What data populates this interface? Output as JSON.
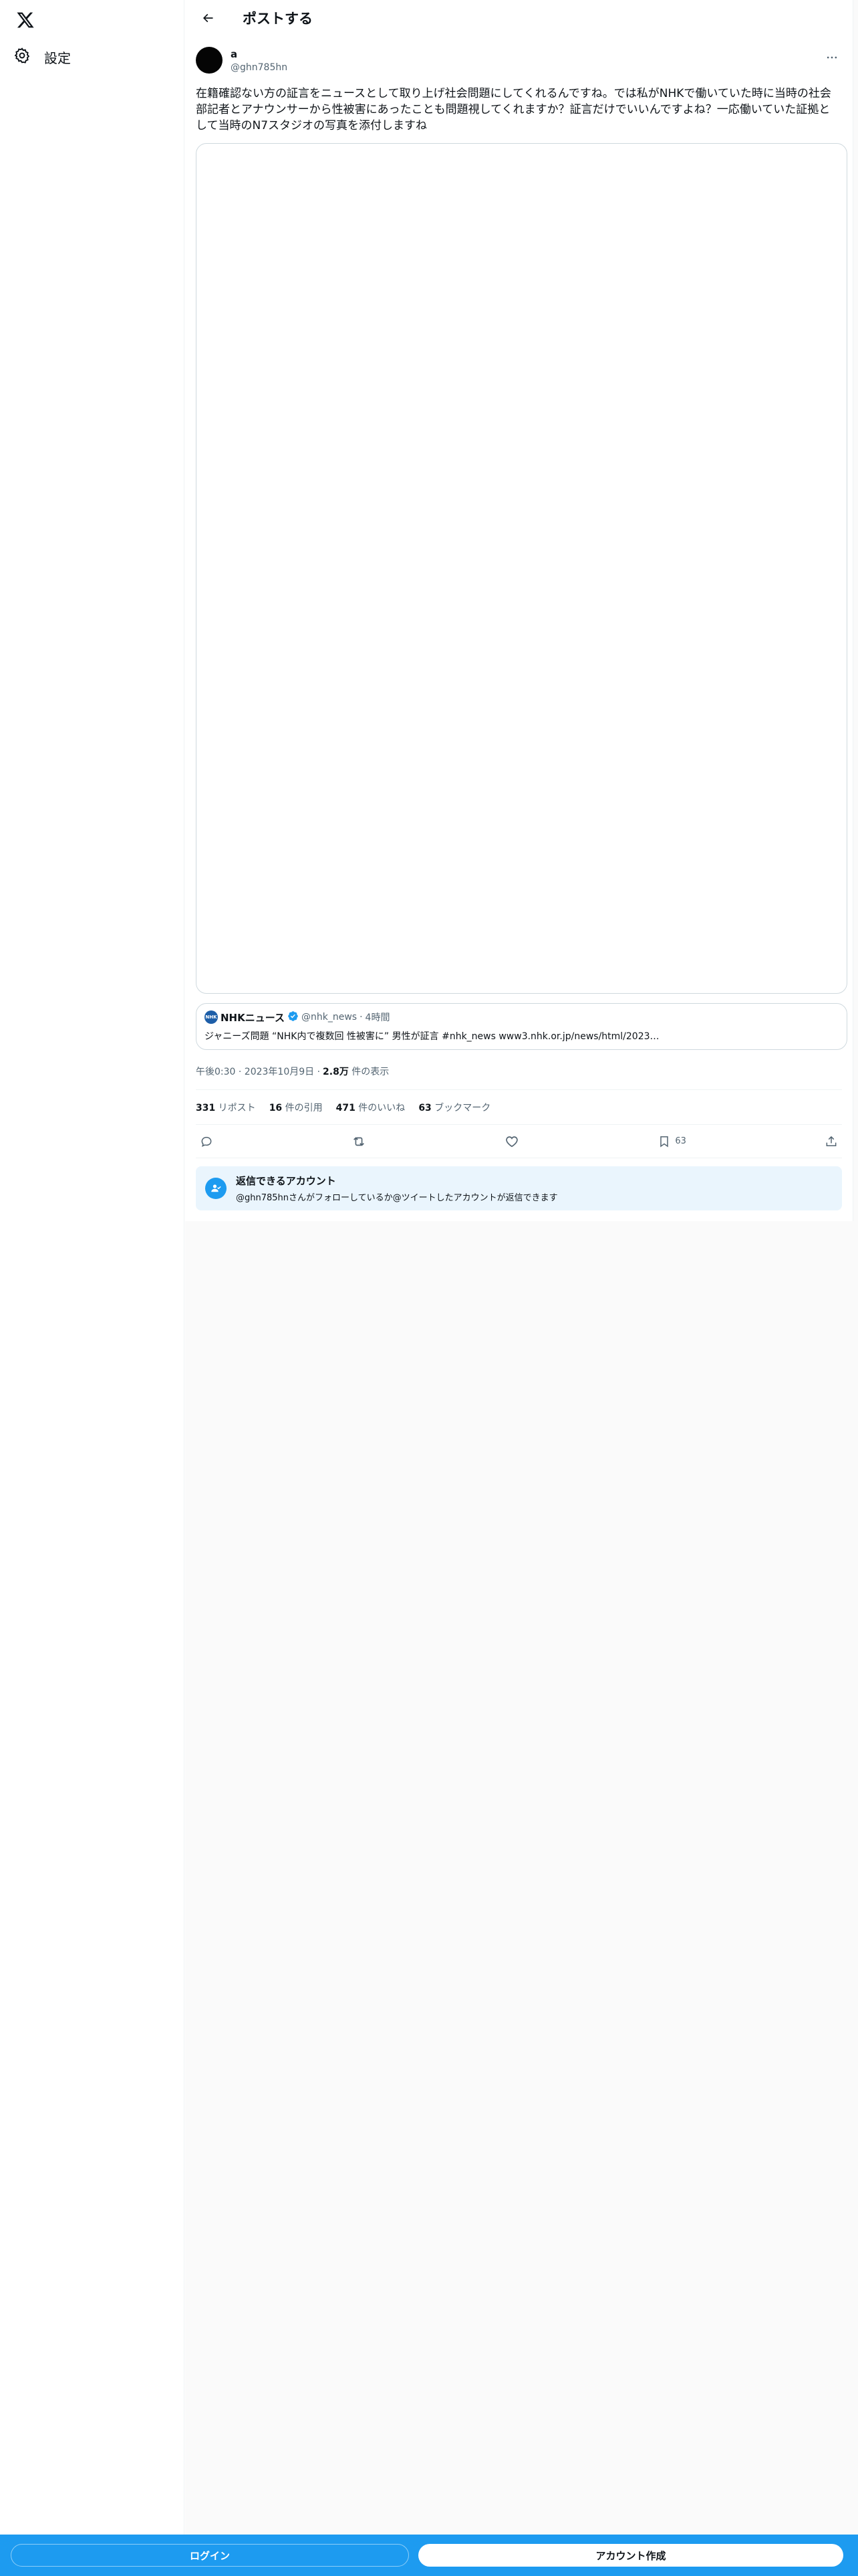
{
  "sidebar": {
    "logo_icon": "x-logo-icon",
    "settings_label": "設定"
  },
  "header": {
    "title": "ポストする"
  },
  "post": {
    "author_name": "a",
    "author_handle": "@ghn785hn",
    "text": "在籍確認ない方の証言をニュースとして取り上げ社会問題にしてくれるんですね。では私がNHKで働いていた時に当時の社会部記者とアナウンサーから性被害にあったことも問題視してくれますか？証言だけでいいんですよね？一応働いていた証拠として当時のN7スタジオの写真を添付しますね",
    "timestamp": "午後0:30 · 2023年10月9日 · ",
    "views_count": "2.8万",
    "views_label": " 件の表示"
  },
  "quote": {
    "avatar_text": "NHK",
    "name": "NHKニュース",
    "handle": "@nhk_news",
    "separator": "·",
    "time": "4時間",
    "text": "ジャニーズ問題 “NHK内で複数回 性被害に” 男性が証言 #nhk_news www3.nhk.or.jp/news/html/2023…"
  },
  "stats": {
    "reposts_count": "331",
    "reposts_label": " リポスト",
    "quotes_count": "16",
    "quotes_label": " 件の引用",
    "likes_count": "471",
    "likes_label": " 件のいいね",
    "bookmarks_count": "63",
    "bookmarks_label": " ブックマーク"
  },
  "actions": {
    "bookmark_count": "63"
  },
  "reply_banner": {
    "title": "返信できるアカウント",
    "description": "@ghn785hnさんがフォローしているか@ツイートしたアカウントが返信できます"
  },
  "bottom_bar": {
    "login_label": "ログイン",
    "signup_label": "アカウント作成"
  },
  "colors": {
    "accent": "#1d9bf0",
    "banner_bg": "#eaf5fd"
  }
}
